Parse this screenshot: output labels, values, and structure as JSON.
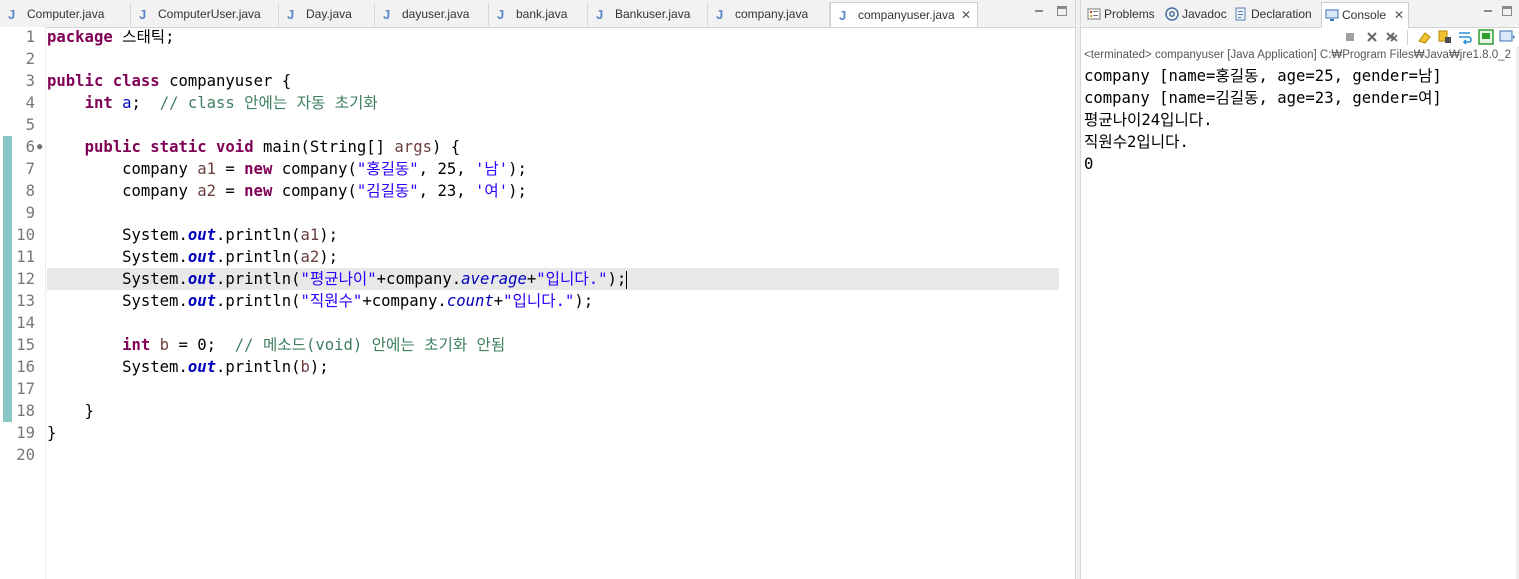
{
  "editor": {
    "tabs": [
      {
        "label": "Computer.java"
      },
      {
        "label": "ComputerUser.java"
      },
      {
        "label": "Day.java"
      },
      {
        "label": "dayuser.java"
      },
      {
        "label": "bank.java"
      },
      {
        "label": "Bankuser.java"
      },
      {
        "label": "company.java"
      },
      {
        "label": "companyuser.java"
      }
    ],
    "active_tab": "companyuser.java",
    "line_numbers": [
      "1",
      "2",
      "3",
      "4",
      "5",
      "6",
      "7",
      "8",
      "9",
      "10",
      "11",
      "12",
      "13",
      "14",
      "15",
      "16",
      "17",
      "18",
      "19",
      "20"
    ],
    "code": {
      "l1_kw": "package",
      "l1_rest": " 스태틱;",
      "l3_kw1": "public",
      "l3_kw2": "class",
      "l3_rest": " companyuser {",
      "l4_kw": "int",
      "l4_var": " a",
      "l4_rest": ";  ",
      "l4_cm": "// class 안에는 자동 초기화",
      "l6_kw1": "public",
      "l6_kw2": "static",
      "l6_kw3": "void",
      "l6_a": " main(String[] ",
      "l6_var": "args",
      "l6_b": ") {",
      "l7_a": "company ",
      "l7_var": "a1",
      "l7_b": " = ",
      "l7_kw": "new",
      "l7_c": " company(",
      "l7_s1": "\"홍길동\"",
      "l7_d": ", 25, ",
      "l7_s2": "'남'",
      "l7_e": ");",
      "l8_a": "company ",
      "l8_var": "a2",
      "l8_b": " = ",
      "l8_kw": "new",
      "l8_c": " company(",
      "l8_s1": "\"김길동\"",
      "l8_d": ", 23, ",
      "l8_s2": "'여'",
      "l8_e": ");",
      "l10_a": "System.",
      "l10_out": "out",
      "l10_b": ".println(",
      "l10_var": "a1",
      "l10_c": ");",
      "l11_a": "System.",
      "l11_out": "out",
      "l11_b": ".println(",
      "l11_var": "a2",
      "l11_c": ");",
      "l12_a": "System.",
      "l12_out": "out",
      "l12_b": ".println(",
      "l12_s1": "\"평균나이\"",
      "l12_c": "+company.",
      "l12_f": "average",
      "l12_d": "+",
      "l12_s2": "\"입니다.\"",
      "l12_e": ");",
      "l13_a": "System.",
      "l13_out": "out",
      "l13_b": ".println(",
      "l13_s1": "\"직원수\"",
      "l13_c": "+company.",
      "l13_f": "count",
      "l13_d": "+",
      "l13_s2": "\"입니다.\"",
      "l13_e": ");",
      "l15_kw": "int",
      "l15_var": " b",
      "l15_a": " = 0;  ",
      "l15_cm": "// 메소드(void) 안에는 초기화 안됨",
      "l16_a": "System.",
      "l16_out": "out",
      "l16_b": ".println(",
      "l16_var": "b",
      "l16_c": ");",
      "l18": "}",
      "l19": "}"
    }
  },
  "views": {
    "tabs": [
      {
        "label": "Problems",
        "icon": "problems-icon"
      },
      {
        "label": "Javadoc",
        "icon": "javadoc-icon"
      },
      {
        "label": "Declaration",
        "icon": "declaration-icon"
      },
      {
        "label": "Console",
        "icon": "console-icon"
      }
    ],
    "active_tab": "Console"
  },
  "console": {
    "status": "<terminated> companyuser [Java Application] C:₩Program Files₩Java₩jre1.8.0_2",
    "output": [
      "company [name=홍길동, age=25, gender=남]",
      "company [name=김길동, age=23, gender=여]",
      "평균나이24입니다.",
      "직원수2입니다.",
      "0"
    ],
    "toolbar_icons": [
      "terminate-icon",
      "remove-launch-icon",
      "remove-all-icon",
      "clear-console-icon",
      "scroll-lock-icon",
      "word-wrap-icon",
      "show-console-icon",
      "display-selected-console-icon"
    ]
  },
  "colors": {
    "keyword": "#7f0055",
    "string": "#2a00ff",
    "comment": "#3f7f5f",
    "field": "#0000c0",
    "change_bar": "#88c6c6"
  }
}
